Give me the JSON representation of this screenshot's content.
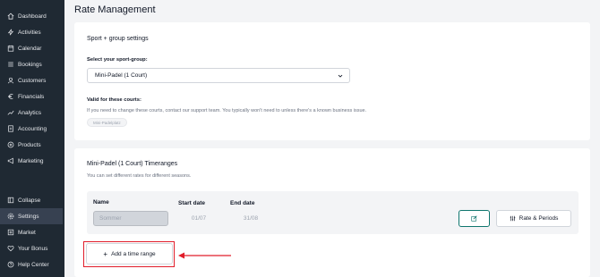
{
  "sidebar": {
    "top_items": [
      {
        "label": "Dashboard",
        "icon": "home-icon"
      },
      {
        "label": "Activities",
        "icon": "lightning-icon"
      },
      {
        "label": "Calendar",
        "icon": "calendar-icon"
      },
      {
        "label": "Bookings",
        "icon": "list-icon"
      },
      {
        "label": "Customers",
        "icon": "user-icon"
      },
      {
        "label": "Financials",
        "icon": "euro-icon"
      },
      {
        "label": "Analytics",
        "icon": "chart-icon"
      },
      {
        "label": "Accounting",
        "icon": "document-icon"
      },
      {
        "label": "Products",
        "icon": "tag-icon"
      },
      {
        "label": "Marketing",
        "icon": "megaphone-icon"
      }
    ],
    "bottom_items": [
      {
        "label": "Collapse",
        "icon": "collapse-icon"
      },
      {
        "label": "Settings",
        "icon": "gear-icon",
        "active": true
      },
      {
        "label": "Market",
        "icon": "plus-square-icon"
      },
      {
        "label": "Your Bonus",
        "icon": "heart-icon"
      },
      {
        "label": "Help Center",
        "icon": "help-icon"
      }
    ]
  },
  "page": {
    "title": "Rate Management"
  },
  "sport_settings": {
    "title": "Sport + group settings",
    "select_label": "Select your sport-group:",
    "selected_group": "Mini-Padel (1 Court)",
    "courts_label": "Valid for these courts:",
    "courts_help": "If you need to change these courts, contact our support team. You typically won't need to unless there's a known business issue.",
    "court_tag": "Mini-Padelplatz"
  },
  "timeranges": {
    "title": "Mini-Padel (1 Court) Timeranges",
    "subtitle": "You can set different rates for different seasons.",
    "col_name": "Name",
    "col_start": "Start date",
    "col_end": "End date",
    "row": {
      "name": "Sommer",
      "start": "01/07",
      "end": "31/08"
    },
    "rate_button": "Rate & Periods",
    "add_button": "Add a time range"
  },
  "colors": {
    "sidebar_bg": "#1f2933",
    "accent": "#0f766e",
    "highlight": "#e11d2a"
  }
}
